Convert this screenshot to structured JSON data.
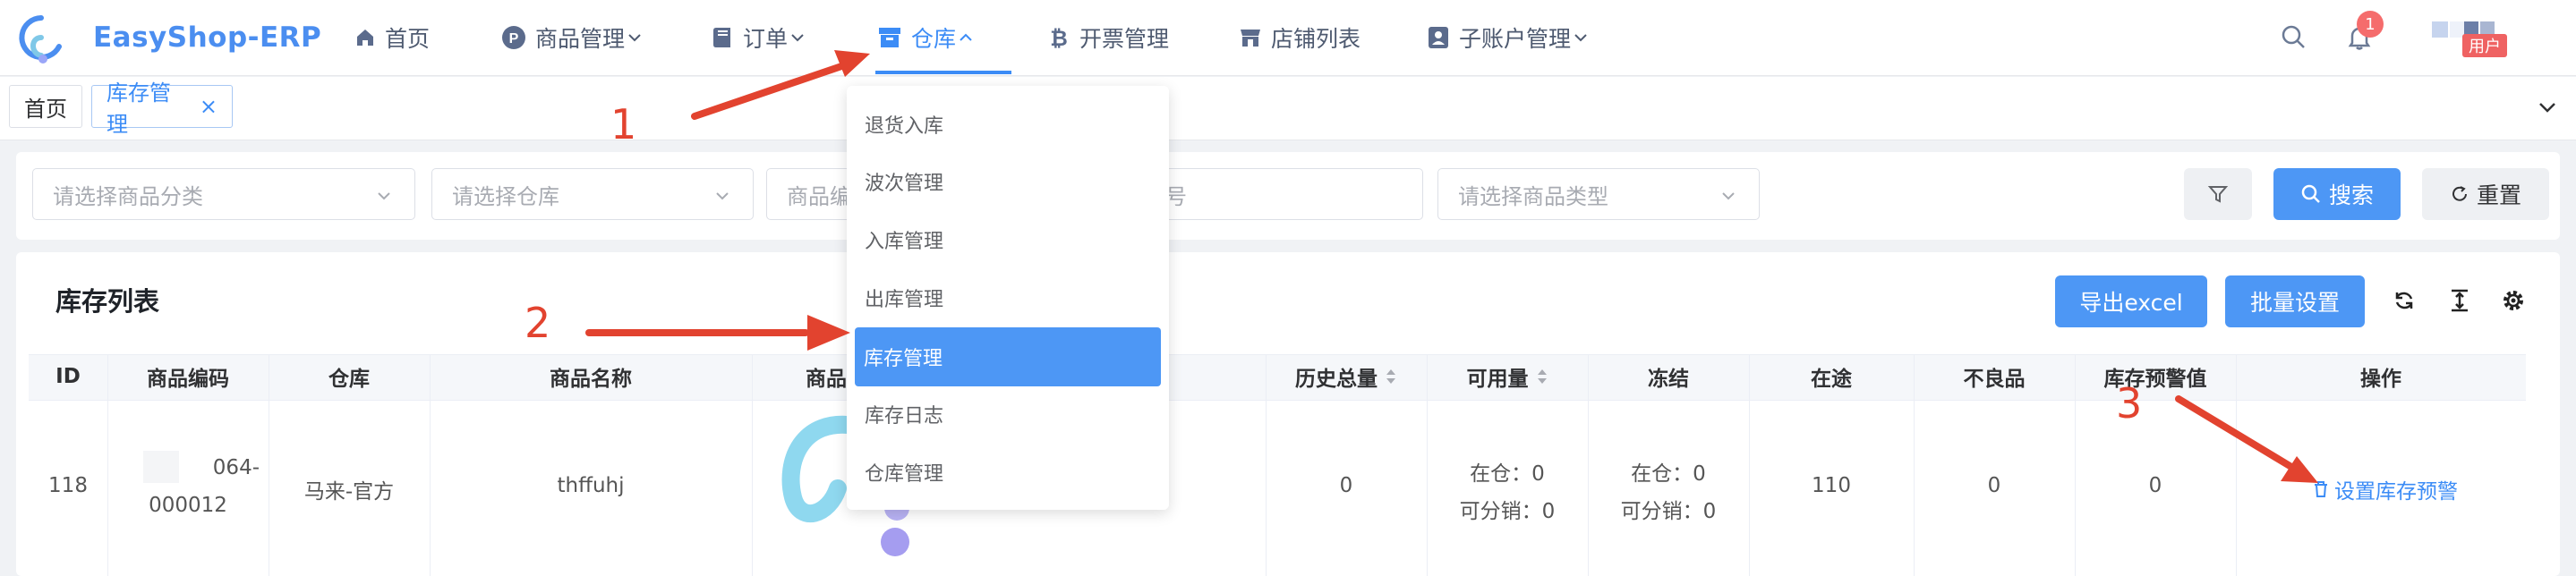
{
  "app": {
    "brand": "EasyShop-ERP"
  },
  "nav": {
    "items": [
      {
        "label": "首页",
        "icon": "home-icon"
      },
      {
        "label": "商品管理",
        "icon": "product-p-icon"
      },
      {
        "label": "订单",
        "icon": "book-icon"
      },
      {
        "label": "仓库",
        "icon": "warehouse-box-icon",
        "active": true
      },
      {
        "label": "开票管理",
        "icon": "bitcoin-icon"
      },
      {
        "label": "店铺列表",
        "icon": "store-icon"
      },
      {
        "label": "子账户管理",
        "icon": "user-badge-icon"
      }
    ],
    "notification_count": "1",
    "user_badge": "用户"
  },
  "tabs": [
    {
      "label": "首页"
    },
    {
      "label": "库存管理",
      "close": "×"
    }
  ],
  "filters": {
    "category_placeholder": "请选择商品分类",
    "warehouse_placeholder": "请选择仓库",
    "product_code_placeholder": "商品编",
    "order_no_placeholder": "单号",
    "product_type_placeholder": "请选择商品类型",
    "search_label": "搜索",
    "reset_label": "重置"
  },
  "table": {
    "title": "库存列表",
    "export_label": "导出excel",
    "batch_label": "批量设置",
    "columns": [
      "ID",
      "商品编码",
      "仓库",
      "商品名称",
      "商品",
      "历史总量",
      "可用量",
      "冻结",
      "在途",
      "不良品",
      "库存预警值",
      "操作"
    ],
    "rows": [
      {
        "id": "118",
        "code_line1": "064-",
        "code_line2": "000012",
        "warehouse": "马来-官方",
        "name": "thffuhj",
        "history_total": "0",
        "avail_in_stock": "在仓：0",
        "avail_sellable": "可分销：0",
        "frozen_in_stock": "在仓：0",
        "frozen_sellable": "可分销：0",
        "in_transit": "110",
        "defective": "0",
        "warning_value": "0",
        "action": "设置库存预警"
      }
    ]
  },
  "dropdown": {
    "items": [
      "退货入库",
      "波次管理",
      "入库管理",
      "出库管理",
      "库存管理",
      "库存日志",
      "仓库管理"
    ],
    "highlighted_index": 4
  },
  "annotations": [
    "1",
    "2",
    "3"
  ],
  "colors": {
    "accent": "#3c8cf6",
    "arrow": "#e2432f",
    "highlight": "#4d97f5"
  }
}
